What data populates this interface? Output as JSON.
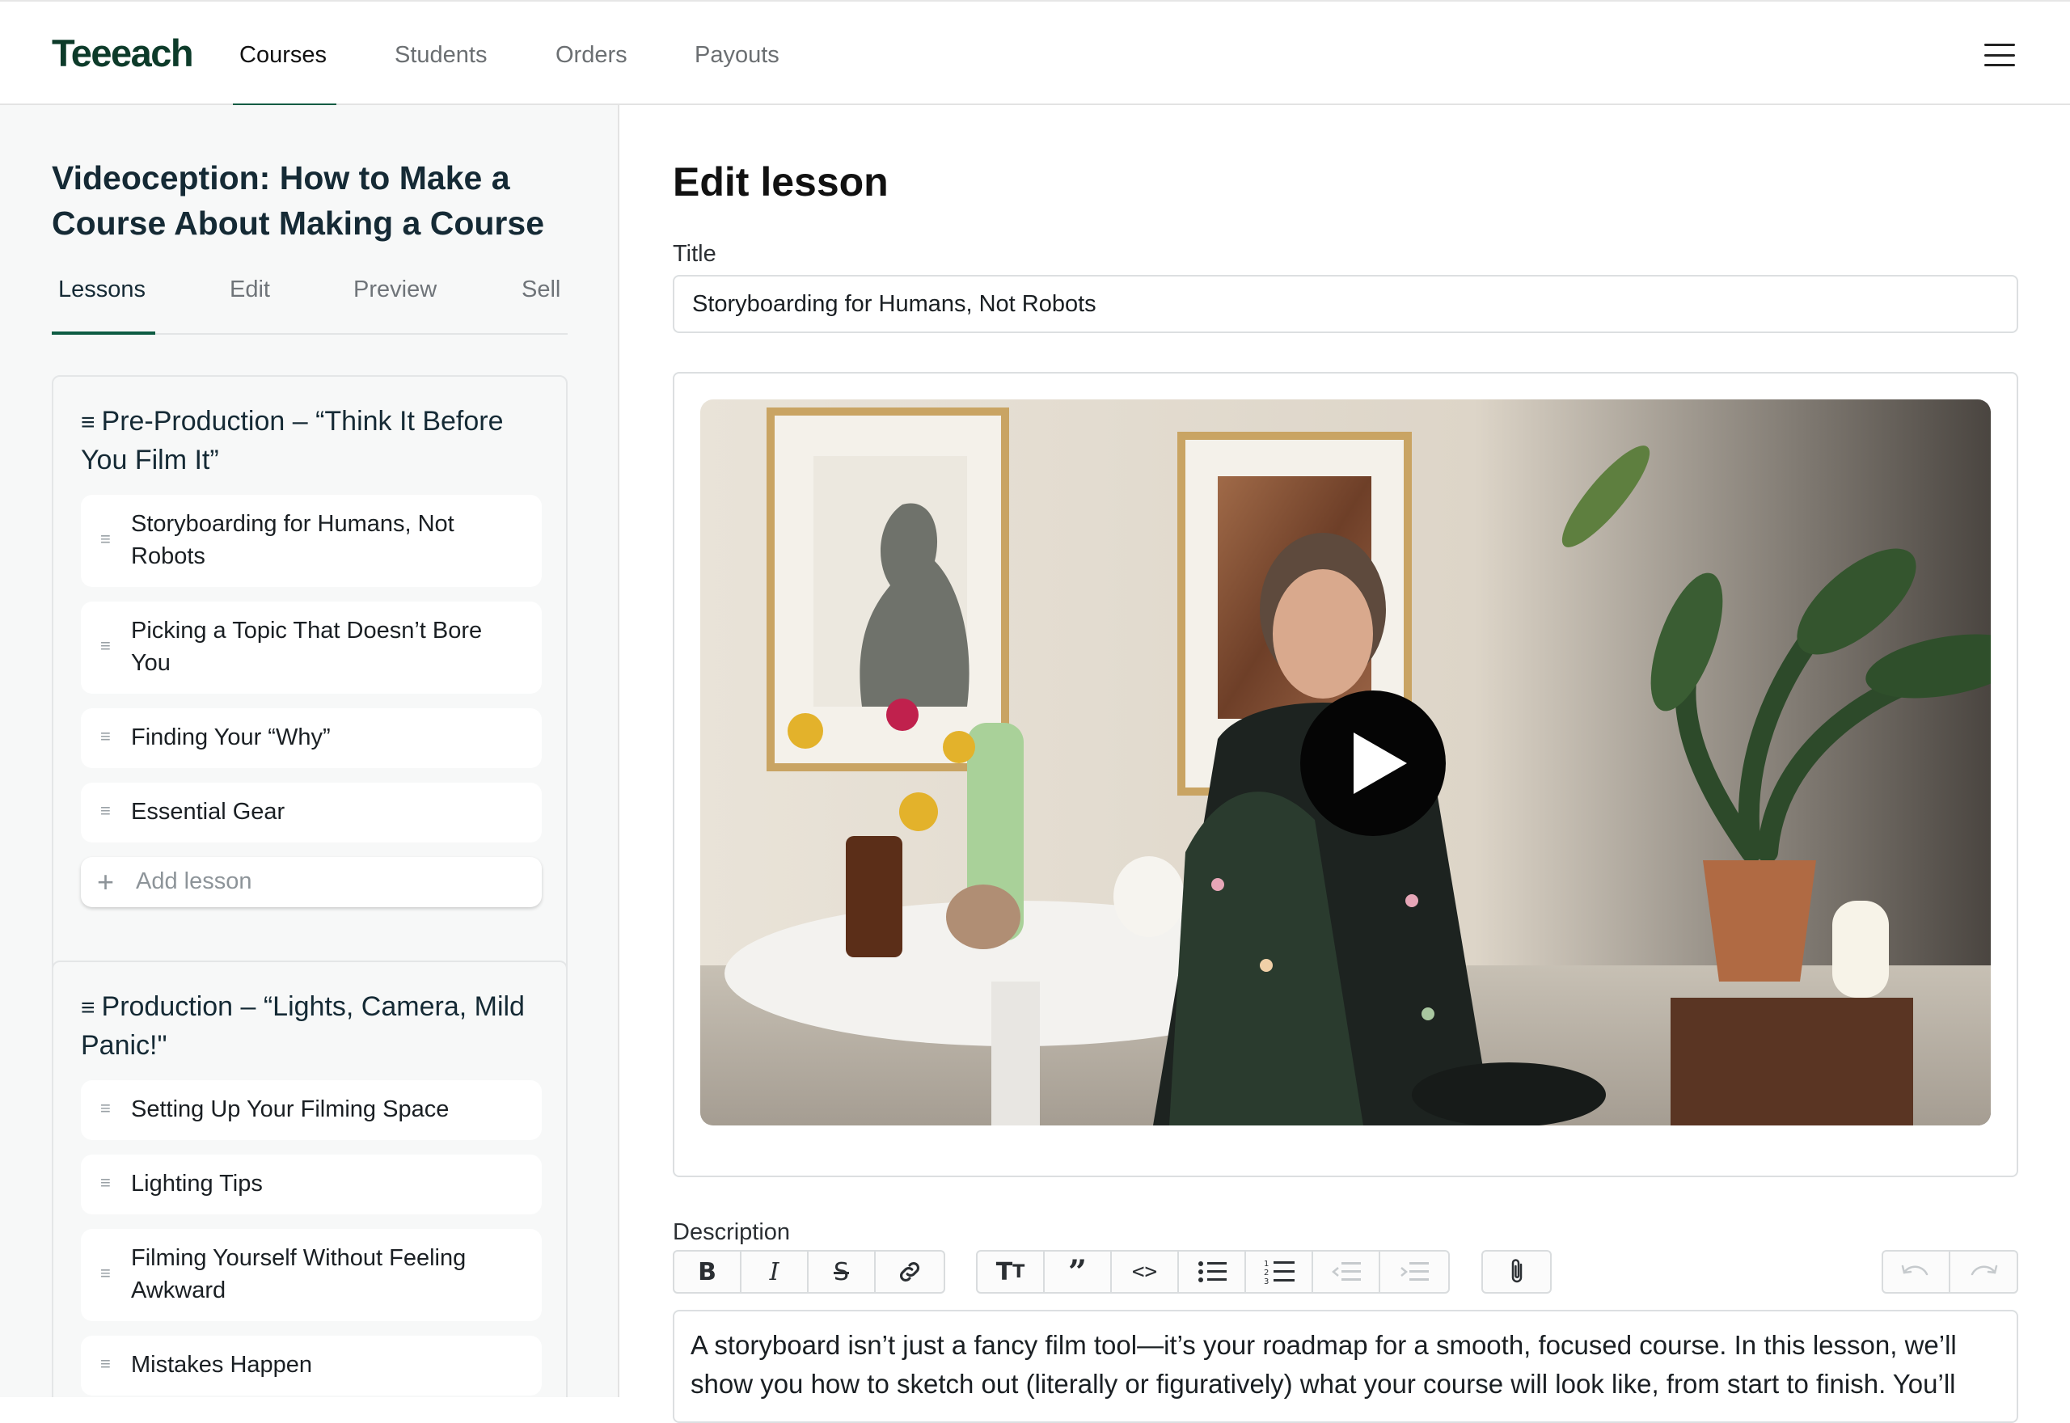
{
  "nav": {
    "logo": "Teeeach",
    "tabs": [
      "Courses",
      "Students",
      "Orders",
      "Payouts"
    ],
    "active_tab": "Courses"
  },
  "course": {
    "title": "Videoception: How to Make a Course About Making a Course",
    "subtabs": [
      "Lessons",
      "Edit",
      "Preview",
      "Sell"
    ],
    "active_subtab": "Lessons"
  },
  "modules": [
    {
      "title": "Pre-Production – “Think It Before You Film It”",
      "lessons": [
        "Storyboarding for Humans, Not Robots",
        "Picking a Topic That Doesn’t Bore You",
        "Finding Your “Why”",
        "Essential Gear"
      ],
      "add_lesson_label": "Add lesson"
    },
    {
      "title": "Production – “Lights, Camera, Mild Panic!\"",
      "lessons": [
        "Setting Up Your Filming Space",
        "Lighting Tips",
        "Filming Yourself Without Feeling Awkward",
        "Mistakes Happen"
      ]
    }
  ],
  "editor": {
    "heading": "Edit lesson",
    "title_label": "Title",
    "title_value": "Storyboarding for Humans, Not Robots",
    "description_label": "Description",
    "description_text": "A storyboard isn’t just a fancy film tool—it’s your roadmap for a smooth, focused course. In this lesson, we’ll show you how to sketch out (literally or figuratively) what your course will look like, from start to finish. You’ll"
  },
  "toolbar": {
    "format": [
      "bold-icon",
      "italic-icon",
      "strikethrough-icon",
      "link-icon"
    ],
    "blocks": [
      "heading-icon",
      "quote-icon",
      "code-icon",
      "bullet-list-icon",
      "numbered-list-icon",
      "outdent-icon",
      "indent-icon"
    ],
    "attach": [
      "attachment-icon"
    ],
    "history": [
      "undo-icon",
      "redo-icon"
    ]
  },
  "colors": {
    "brand": "#0d5c43",
    "logo": "#0d3b2a",
    "sidebar_bg": "#f7f8f8"
  }
}
